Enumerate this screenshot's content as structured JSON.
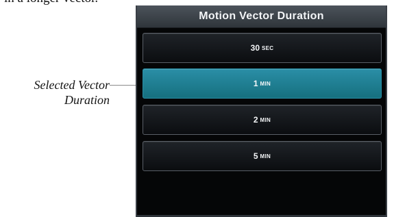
{
  "top_text": "in a longer vector.",
  "callout": {
    "line1": "Selected Vector",
    "line2": "Duration"
  },
  "screen": {
    "title": "Motion Vector Duration",
    "selected_value": "1 MIN",
    "options": [
      {
        "num": "30",
        "unit": "SEC",
        "selected": false
      },
      {
        "num": "1",
        "unit": "MIN",
        "selected": true
      },
      {
        "num": "2",
        "unit": "MIN",
        "selected": false
      },
      {
        "num": "5",
        "unit": "MIN",
        "selected": false
      }
    ]
  },
  "colors": {
    "selected_fill": "#1f7f94",
    "button_fill": "#12151a",
    "title_bar": "#3e444b"
  }
}
